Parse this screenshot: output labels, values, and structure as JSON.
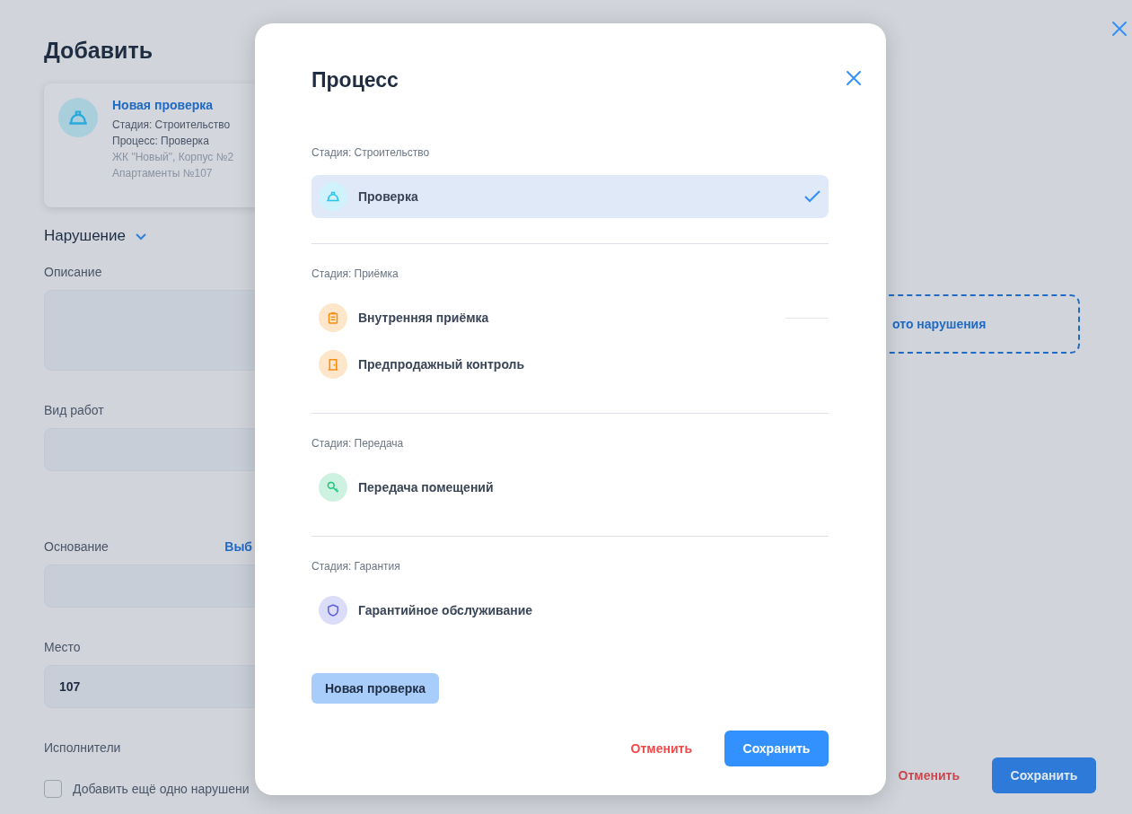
{
  "page": {
    "title": "Добавить",
    "card": {
      "title": "Новая проверка",
      "lines": [
        {
          "text": "Стадия: Строительство",
          "muted": false
        },
        {
          "text": "Процесс: Проверка",
          "muted": false
        },
        {
          "text": "ЖК \"Новый\", Корпус №2",
          "muted": true
        },
        {
          "text": "Апартаменты №107",
          "muted": true
        }
      ]
    },
    "section": {
      "title": "Нарушение",
      "expanded": true
    },
    "fields": [
      {
        "label": "Описание",
        "kind": "textarea"
      },
      {
        "label": "Вид работ",
        "kind": "input"
      },
      {
        "label": "Основание",
        "kind": "input",
        "link": "Выб"
      },
      {
        "label": "Место",
        "kind": "input",
        "value": "107"
      },
      {
        "label": "Исполнители",
        "kind": "label"
      }
    ],
    "add_another": {
      "label": "Добавить ещё одно нарушени",
      "checked": false
    },
    "upload": {
      "label": "ото нарушения"
    },
    "buttons": {
      "cancel": "Отменить",
      "save": "Сохранить"
    }
  },
  "dialog": {
    "title": "Процесс",
    "sections": [
      {
        "label": "Стадия: Строительство",
        "items": [
          {
            "label": "Проверка",
            "kind": "helmet",
            "selected": true
          }
        ]
      },
      {
        "label": "Стадия: Приёмка",
        "items": [
          {
            "label": "Внутренняя приёмка",
            "kind": "clipboard",
            "selected": false
          },
          {
            "label": "Предпродажный контроль",
            "kind": "door",
            "selected": false
          }
        ]
      },
      {
        "label": "Стадия: Передача",
        "items": [
          {
            "label": "Передача помещений",
            "kind": "key",
            "selected": false
          }
        ]
      },
      {
        "label": "Стадия: Гарантия",
        "items": [
          {
            "label": "Гарантийное обслуживание",
            "kind": "shield",
            "selected": false
          }
        ]
      }
    ],
    "new_button": "Новая проверка",
    "buttons": {
      "cancel": "Отменить",
      "save": "Сохранить"
    }
  }
}
